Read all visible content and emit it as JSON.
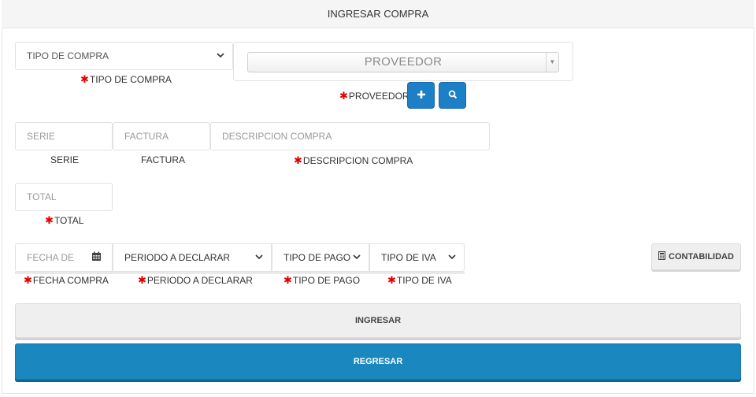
{
  "header": {
    "title": "INGRESAR COMPRA"
  },
  "tipo_compra": {
    "value": "TIPO DE COMPRA",
    "label": "TIPO DE COMPRA"
  },
  "proveedor": {
    "value": "PROVEEDOR",
    "label": "PROVEEDOR",
    "add_icon": "plus-icon",
    "search_icon": "search-icon"
  },
  "serie": {
    "placeholder": "SERIE",
    "label": "SERIE"
  },
  "factura": {
    "placeholder": "FACTURA",
    "label": "FACTURA"
  },
  "descripcion": {
    "placeholder": "DESCRIPCION COMPRA",
    "label": "DESCRIPCION COMPRA"
  },
  "total": {
    "placeholder": "TOTAL",
    "label": "TOTAL"
  },
  "fecha": {
    "placeholder": "FECHA DE",
    "label": "FECHA COMPRA",
    "icon": "calendar-icon"
  },
  "periodo": {
    "value": "PERIODO A DECLARAR",
    "label": "PERIODO A DECLARAR"
  },
  "tipo_pago": {
    "value": "TIPO DE PAGO",
    "label": "TIPO DE PAGO"
  },
  "tipo_iva": {
    "value": "TIPO DE IVA",
    "label": "TIPO DE IVA"
  },
  "contabilidad": {
    "label": "CONTABILIDAD",
    "icon": "calculator-icon"
  },
  "actions": {
    "ingresar": "INGRESAR",
    "regresar": "REGRESAR"
  },
  "required_mark": "✱",
  "colors": {
    "primary": "#1a87bf",
    "required": "#e00000",
    "header_bg": "#f5f5f5"
  }
}
